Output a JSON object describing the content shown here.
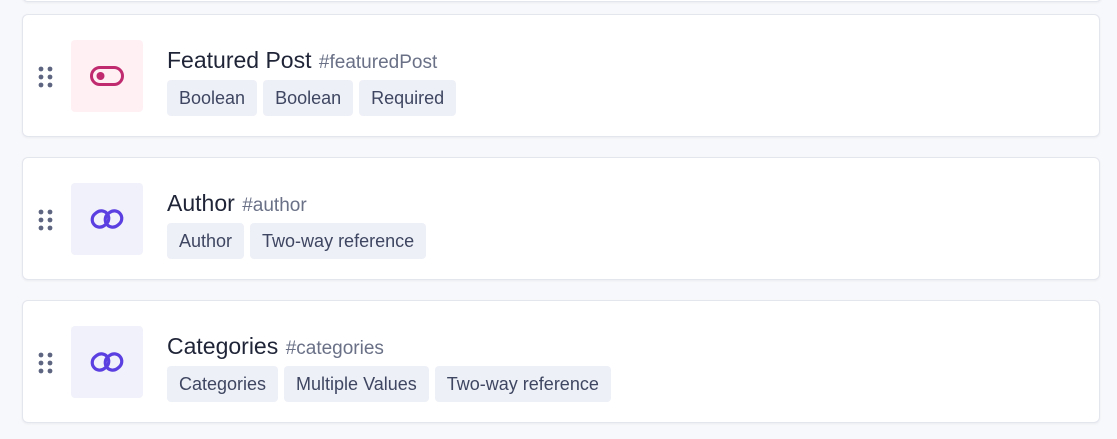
{
  "colors": {
    "boolean_tile_bg": "#fff0f4",
    "boolean_icon": "#c02a6f",
    "reference_tile_bg": "#f1f1fb",
    "reference_icon": "#5b3fe0",
    "handle": "#5d6580"
  },
  "fields": [
    {
      "name": "Featured Post",
      "api_id": "#featuredPost",
      "icon": "toggle-icon",
      "badges": [
        "Boolean",
        "Boolean",
        "Required"
      ]
    },
    {
      "name": "Author",
      "api_id": "#author",
      "icon": "link-icon",
      "badges": [
        "Author",
        "Two-way reference"
      ]
    },
    {
      "name": "Categories",
      "api_id": "#categories",
      "icon": "link-icon",
      "badges": [
        "Categories",
        "Multiple Values",
        "Two-way reference"
      ]
    }
  ]
}
